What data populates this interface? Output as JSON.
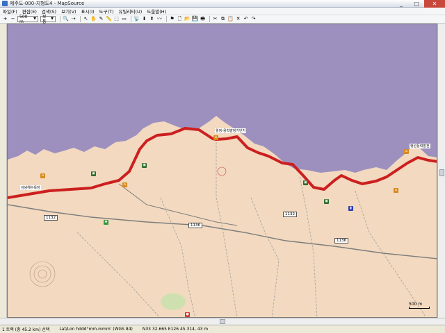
{
  "window": {
    "title": "제주도-000-지형도4 - MapSource",
    "minimize": "_",
    "maximize": "□",
    "close": "✕"
  },
  "menu": [
    "파일(F)",
    "편집(E)",
    "검색(S)",
    "보기(V)",
    "표시(I)",
    "도구(T)",
    "유틸리티(U)",
    "도움말(H)"
  ],
  "toolbar": {
    "zoom_in": "+",
    "zoom_out": "−",
    "zoom_select": "500 m",
    "detail_select": "보통",
    "icons": [
      "mag-icon",
      "route-icon",
      "pointer-icon",
      "hand-icon",
      "draw-icon",
      "measure-icon",
      "select-icon",
      "dash-icon",
      "gps-icon",
      "receive-icon",
      "send-icon",
      "track-icon",
      "waypoint-icon",
      "new-icon",
      "open-icon",
      "save-icon",
      "print-icon",
      "cut-icon",
      "copy-icon",
      "paste-icon",
      "delete-icon",
      "undo-icon",
      "redo-icon"
    ]
  },
  "map": {
    "colors": {
      "sea": "#9d90bf",
      "land": "#f2d9bf",
      "route": "#cc1f1f",
      "roads": "#8a8a8a"
    },
    "labels": {
      "place1": "월정-용학발정기단지",
      "place2": "행원풍력발전",
      "place3": "김녕해수욕장",
      "road1": "1132",
      "road2": "1136",
      "road3": "1136",
      "road4": "1132",
      "scale": "500 m"
    }
  },
  "status": {
    "track": "1 트랙 (총 45.2 km) 선택",
    "format": "Lat/Lon hddd°mm.mmm' (WGS 84)",
    "coords": "N33 32.665 E126 45.314, 43 m"
  }
}
